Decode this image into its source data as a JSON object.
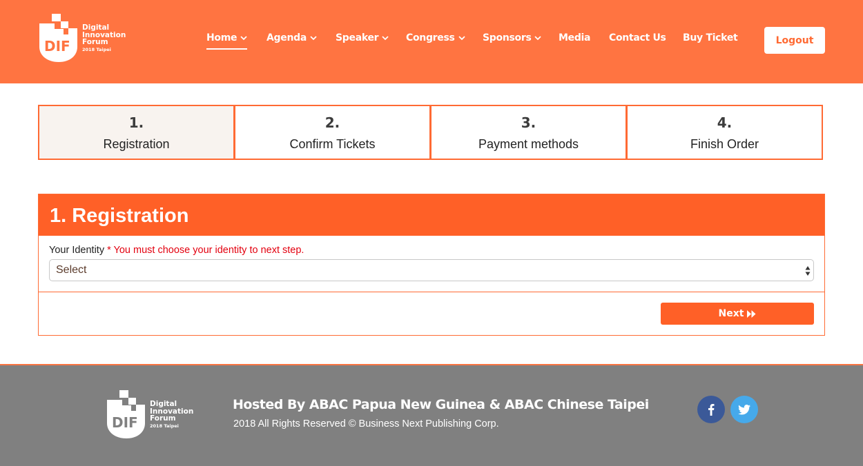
{
  "header": {
    "logo": {
      "abbr": "DIF",
      "line1": "Digital",
      "line2": "Innovation",
      "line3": "Forum",
      "year": "2018 Taipei"
    },
    "nav": [
      {
        "label": "Home",
        "dropdown": true,
        "active": true
      },
      {
        "label": "Agenda",
        "dropdown": true
      },
      {
        "label": "Speaker",
        "dropdown": true
      },
      {
        "label": "Congress",
        "dropdown": true
      },
      {
        "label": "Sponsors",
        "dropdown": true
      },
      {
        "label": "Media",
        "dropdown": false
      },
      {
        "label": "Contact Us",
        "dropdown": false
      },
      {
        "label": "Buy Ticket",
        "dropdown": false
      }
    ],
    "logout_label": "Logout"
  },
  "steps": [
    {
      "num": "1.",
      "label": "Registration",
      "active": true
    },
    {
      "num": "2.",
      "label": "Confirm Tickets"
    },
    {
      "num": "3.",
      "label": "Payment methods"
    },
    {
      "num": "4.",
      "label": "Finish Order"
    }
  ],
  "registration": {
    "title": "1. Registration",
    "identity_label": "Your Identity",
    "required_note": "* You must choose your identity to next step.",
    "select_value": "Select",
    "next_label": "Next"
  },
  "footer": {
    "logo": {
      "abbr": "DIF",
      "line1": "Digital",
      "line2": "Innovation",
      "line3": "Forum",
      "year": "2018 Taipei"
    },
    "hosted": "Hosted By ABAC Papua New Guinea & ABAC Chinese Taipei",
    "copyright": "2018 All Rights Reserved © Business Next Publishing Corp.",
    "social": [
      "facebook-icon",
      "twitter-icon"
    ]
  },
  "colors": {
    "header_bg": "#ff7441",
    "accent": "#ff6027",
    "footer_bg": "#808080",
    "required": "#e3000f",
    "facebook": "#3b5998",
    "twitter": "#46a9ea"
  }
}
